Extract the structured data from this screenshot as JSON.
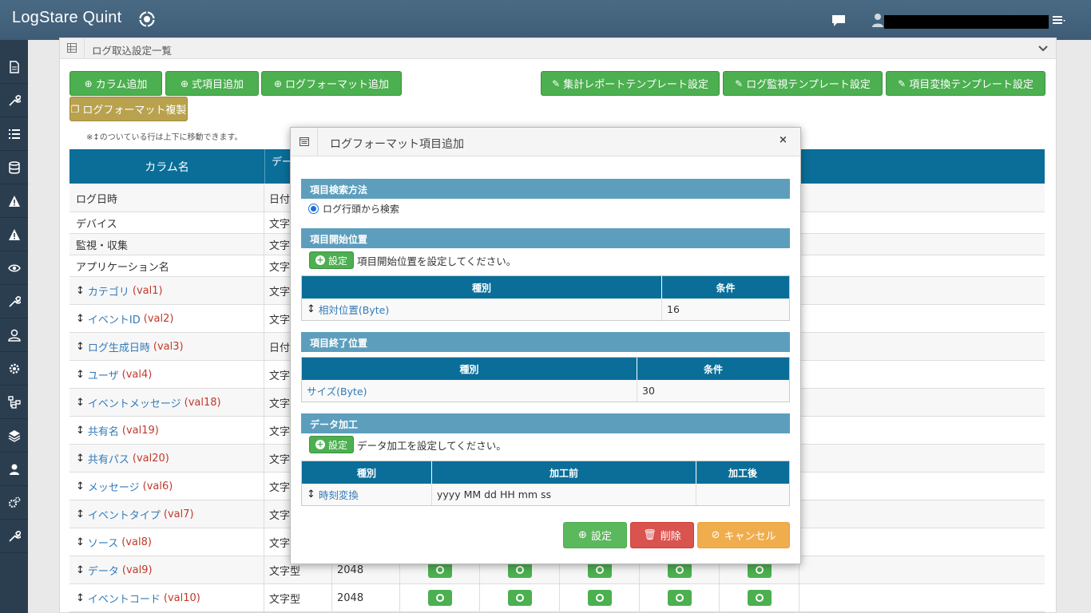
{
  "header": {
    "brand": "LogStare Quint",
    "user_name": "████████████████"
  },
  "colors": {
    "topbar": "#4a6a84",
    "sidebar": "#2b3e50",
    "accent_green": "#4caf50",
    "table_head": "#0a6e99",
    "section": "#5d9ebd"
  },
  "sidebar": {
    "icons": [
      "document-icon",
      "wrench-icon",
      "list-icon",
      "database-icon",
      "warning-icon",
      "warning-icon",
      "eye-icon",
      "wrench-icon",
      "users-icon",
      "gear-icon",
      "sitemap-icon",
      "layers-icon",
      "user-admin-icon",
      "gears-icon",
      "wrench-icon"
    ]
  },
  "panel": {
    "title": "ログ取込設定一覧",
    "buttons": {
      "add_column": "カラム追加",
      "add_expr": "式項目追加",
      "add_format": "ログフォーマット追加",
      "report_template": "集計レポートテンプレート設定",
      "monitor_template": "ログ監視テンプレート設定",
      "convert_template": "項目変換テンプレート設定",
      "copy_format": "ログフォーマット複製"
    },
    "hint": "※↕のついている行は上下に移動できます。",
    "table": {
      "col_name": "カラム名",
      "col_type": "デー",
      "rows": [
        {
          "name": "ログ日時",
          "val": "",
          "type": "日付",
          "size": "",
          "movable": false
        },
        {
          "name": "デバイス",
          "val": "",
          "type": "文字",
          "size": "",
          "movable": false
        },
        {
          "name": "監視・収集",
          "val": "",
          "type": "文字",
          "size": "",
          "movable": false
        },
        {
          "name": "アプリケーション名",
          "val": "",
          "type": "文字",
          "size": "",
          "movable": false
        },
        {
          "name": "カテゴリ",
          "val": "(val1)",
          "type": "文字",
          "size": "",
          "movable": true
        },
        {
          "name": "イベントID",
          "val": "(val2)",
          "type": "文字",
          "size": "",
          "movable": true
        },
        {
          "name": "ログ生成日時",
          "val": "(val3)",
          "type": "日付",
          "size": "",
          "movable": true
        },
        {
          "name": "ユーザ",
          "val": "(val4)",
          "type": "文字",
          "size": "",
          "movable": true
        },
        {
          "name": "イベントメッセージ",
          "val": "(val18)",
          "type": "文字",
          "size": "",
          "movable": true
        },
        {
          "name": "共有名",
          "val": "(val19)",
          "type": "文字",
          "size": "",
          "movable": true
        },
        {
          "name": "共有パス",
          "val": "(val20)",
          "type": "文字",
          "size": "",
          "movable": true
        },
        {
          "name": "メッセージ",
          "val": "(val6)",
          "type": "文字",
          "size": "",
          "movable": true
        },
        {
          "name": "イベントタイプ",
          "val": "(val7)",
          "type": "文字",
          "size": "",
          "movable": true
        },
        {
          "name": "ソース",
          "val": "(val8)",
          "type": "文字",
          "size": "",
          "movable": true
        },
        {
          "name": "データ",
          "val": "(val9)",
          "type": "文字型",
          "size": "2048",
          "movable": true
        },
        {
          "name": "イベントコード",
          "val": "(val10)",
          "type": "文字型",
          "size": "2048",
          "movable": true
        }
      ]
    }
  },
  "modal": {
    "title": "ログフォーマット項目追加",
    "close": "×",
    "search_section": "項目検索方法",
    "radio_label": "ログ行頭から検索",
    "start_section": "項目開始位置",
    "set_label": "設定",
    "start_hint": "項目開始位置を設定してください。",
    "start_table": {
      "col1": "種別",
      "col2": "条件",
      "row_type": "相対位置(Byte)",
      "row_cond": "16"
    },
    "end_section": "項目終了位置",
    "end_table": {
      "col1": "種別",
      "col2": "条件",
      "row_type": "サイズ(Byte)",
      "row_cond": "30"
    },
    "proc_section": "データ加工",
    "proc_hint": "データ加工を設定してください。",
    "proc_table": {
      "col1": "種別",
      "col2": "加工前",
      "col3": "加工後",
      "row_type": "時刻変換",
      "row_before": "yyyy MM dd HH mm ss",
      "row_after": ""
    },
    "footer": {
      "set": "設定",
      "delete": "削除",
      "cancel": "キャンセル"
    }
  }
}
